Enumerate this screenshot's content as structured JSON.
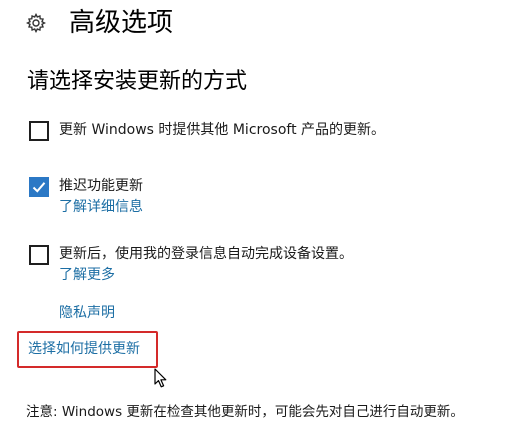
{
  "header": {
    "title": "高级选项",
    "icon": "gear-icon"
  },
  "section": {
    "title": "请选择安装更新的方式"
  },
  "options": [
    {
      "label": "更新 Windows 时提供其他 Microsoft 产品的更新。",
      "checked": false
    },
    {
      "label": "推迟功能更新",
      "checked": true,
      "link": "了解详细信息"
    },
    {
      "label": "更新后，使用我的登录信息自动完成设备设置。",
      "checked": false,
      "link": "了解更多"
    }
  ],
  "links": {
    "privacy": "隐私声明",
    "choose_delivery": "选择如何提供更新"
  },
  "note": "注意: Windows 更新在检查其他更新时，可能会先对自己进行自动更新。",
  "colors": {
    "accent": "#2b78c5",
    "link": "#1c6ea4",
    "highlight": "#d42a2a"
  }
}
